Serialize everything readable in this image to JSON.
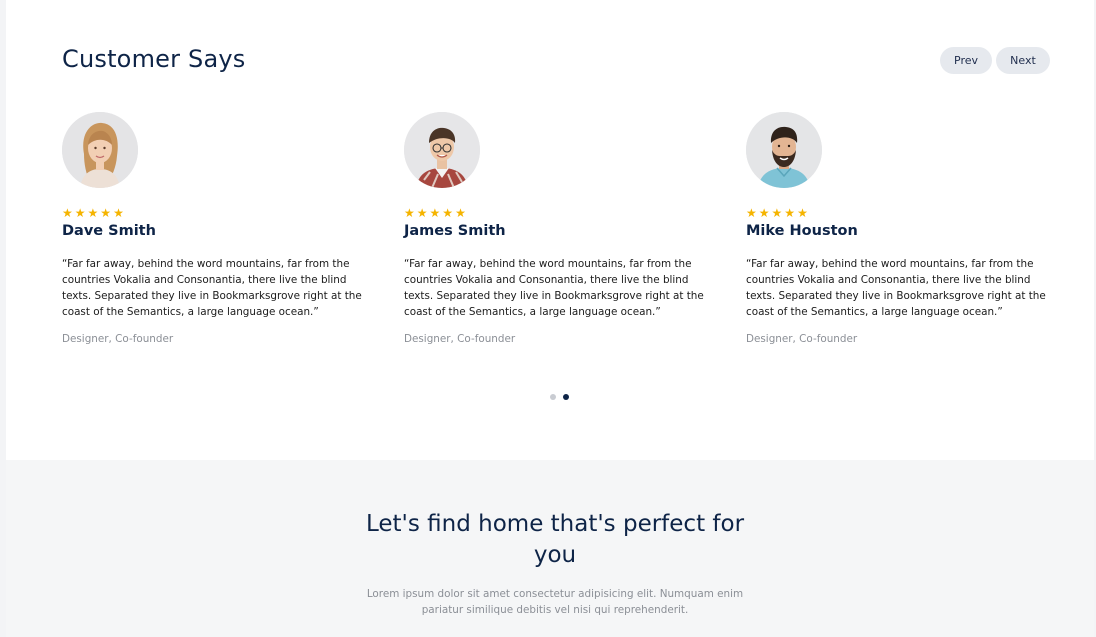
{
  "testimonials": {
    "title": "Customer Says",
    "prev_label": "Prev",
    "next_label": "Next",
    "stars_per_card": 5,
    "star_color": "#f5b400",
    "cards": [
      {
        "name": "Dave Smith",
        "rating": 5,
        "quote_lines": [
          "“Far far away, behind the word mountains, far from the",
          "countries Vokalia and Consonantia, there live the blind",
          "texts. Separated they live in Bookmarksgrove right at the",
          "coast of the Semantics, a large language ocean.”"
        ],
        "role": "Designer, Co-founder",
        "avatar_icon": "woman-portrait"
      },
      {
        "name": "James Smith",
        "rating": 5,
        "quote_lines": [
          "“Far far away, behind the word mountains, far from the",
          "countries Vokalia and Consonantia, there live the blind",
          "texts. Separated they live in Bookmarksgrove right at the",
          "coast of the Semantics, a large language ocean.”"
        ],
        "role": "Designer, Co-founder",
        "avatar_icon": "man-glasses-portrait"
      },
      {
        "name": "Mike Houston",
        "rating": 5,
        "quote_lines": [
          "“Far far away, behind the word mountains, far from the",
          "countries Vokalia and Consonantia, there live the blind",
          "texts. Separated they live in Bookmarksgrove right at the",
          "coast of the Semantics, a large language ocean.”"
        ],
        "role": "Designer, Co-founder",
        "avatar_icon": "man-beard-portrait"
      }
    ],
    "pagination": {
      "pages": 2,
      "active_page": 2
    }
  },
  "cta": {
    "heading_lines": [
      "Let's find home that's perfect for",
      "you"
    ],
    "text_lines": [
      "Lorem ipsum dolor sit amet consectetur adipisicing elit. Numquam enim",
      "pariatur similique debitis vel nisi qui reprehenderit."
    ]
  },
  "colors": {
    "heading": "#0e2447",
    "button_bg": "#e6e9ee",
    "muted_text": "#8b8f96",
    "cta_bg": "#f5f6f7"
  }
}
